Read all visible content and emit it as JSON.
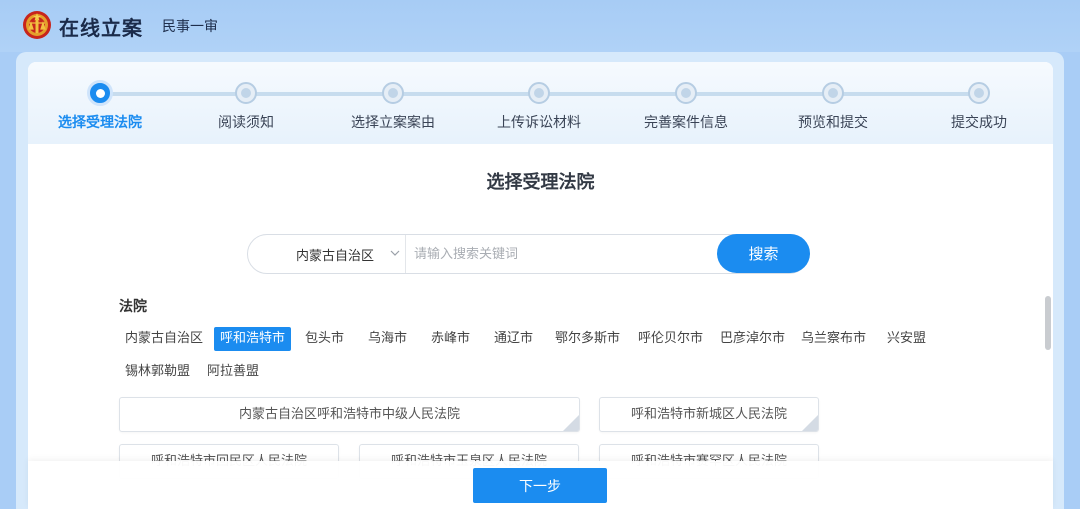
{
  "header": {
    "title": "在线立案",
    "subtitle": "民事一审",
    "logo_icon": "court-emblem-icon"
  },
  "steps": [
    {
      "label": "选择受理法院",
      "active": true
    },
    {
      "label": "阅读须知",
      "active": false
    },
    {
      "label": "选择立案案由",
      "active": false
    },
    {
      "label": "上传诉讼材料",
      "active": false
    },
    {
      "label": "完善案件信息",
      "active": false
    },
    {
      "label": "预览和提交",
      "active": false
    },
    {
      "label": "提交成功",
      "active": false
    }
  ],
  "page": {
    "title": "选择受理法院"
  },
  "search": {
    "region_value": "内蒙古自治区",
    "placeholder": "请输入搜索关键词",
    "button_label": "搜索"
  },
  "courts_section": {
    "label": "法院",
    "cities": [
      {
        "label": "内蒙古自治区",
        "selected": false
      },
      {
        "label": "呼和浩特市",
        "selected": true
      },
      {
        "label": "包头市",
        "selected": false
      },
      {
        "label": "乌海市",
        "selected": false
      },
      {
        "label": "赤峰市",
        "selected": false
      },
      {
        "label": "通辽市",
        "selected": false
      },
      {
        "label": "鄂尔多斯市",
        "selected": false
      },
      {
        "label": "呼伦贝尔市",
        "selected": false
      },
      {
        "label": "巴彦淖尔市",
        "selected": false
      },
      {
        "label": "乌兰察布市",
        "selected": false
      },
      {
        "label": "兴安盟",
        "selected": false
      },
      {
        "label": "锡林郭勒盟",
        "selected": false
      },
      {
        "label": "阿拉善盟",
        "selected": false
      }
    ],
    "courts": [
      {
        "label": "内蒙古自治区呼和浩特市中级人民法院"
      },
      {
        "label": "呼和浩特市新城区人民法院"
      },
      {
        "label": "呼和浩特市回民区人民法院"
      },
      {
        "label": "呼和浩特市玉泉区人民法院"
      },
      {
        "label": "呼和浩特市赛罕区人民法院"
      }
    ]
  },
  "footer": {
    "next_label": "下一步"
  },
  "colors": {
    "accent": "#1b8cf0",
    "background": "#a9cdf6"
  }
}
